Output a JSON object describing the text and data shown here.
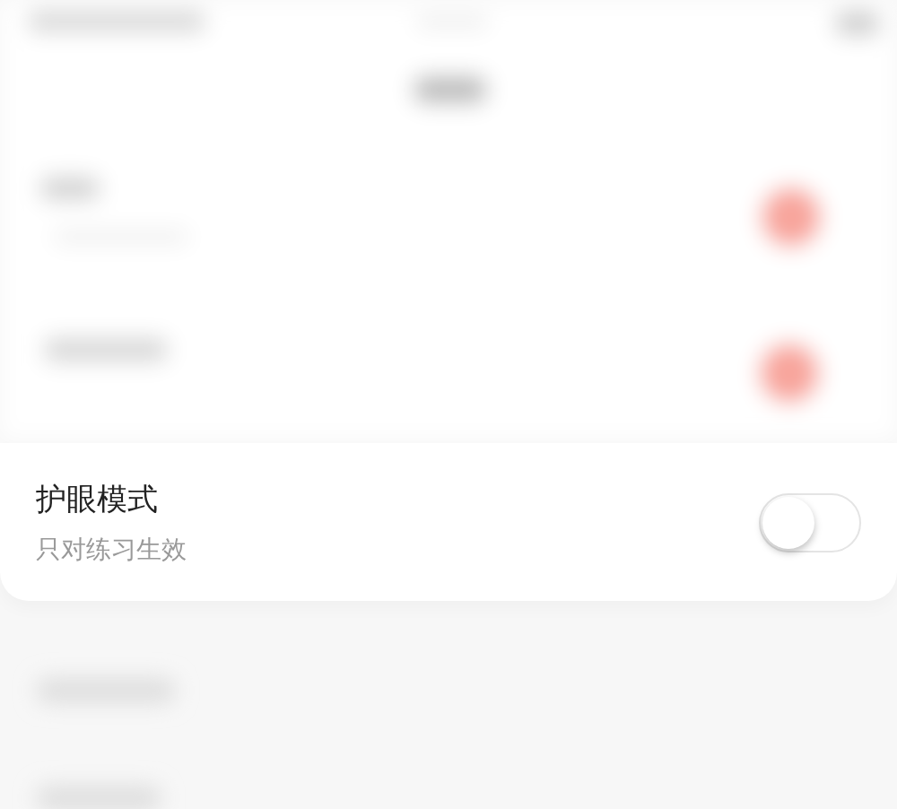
{
  "setting": {
    "title": "护眼模式",
    "subtitle": "只对练习生效",
    "on": false
  }
}
